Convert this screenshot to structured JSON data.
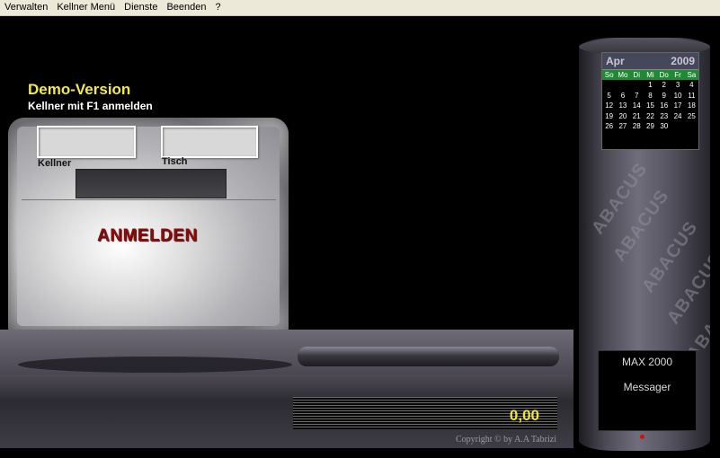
{
  "menu": {
    "items": [
      "Verwalten",
      "Kellner Menü",
      "Dienste",
      "Beenden",
      "?"
    ]
  },
  "banner": {
    "title": "Demo-Version",
    "subtitle": "Kellner mit F1 anmelden"
  },
  "login": {
    "kellner_label": "Kellner",
    "tisch_label": "Tisch",
    "kellner_value": "",
    "tisch_value": "",
    "display_value": "",
    "button_label": "ANMELDEN"
  },
  "display": {
    "amount": "0,00"
  },
  "copyright": "Copyright © by A.A Tabrizi",
  "watermark": "ABACUS",
  "calendar": {
    "month": "Apr",
    "year": "2009",
    "weekdays": [
      "So",
      "Mo",
      "Di",
      "Mi",
      "Do",
      "Fr",
      "Sa"
    ],
    "days": [
      "",
      "",
      "",
      "1",
      "2",
      "3",
      "4",
      "5",
      "6",
      "7",
      "8",
      "9",
      "10",
      "11",
      "12",
      "13",
      "14",
      "15",
      "16",
      "17",
      "18",
      "19",
      "20",
      "21",
      "22",
      "23",
      "24",
      "25",
      "26",
      "27",
      "28",
      "29",
      "30"
    ]
  },
  "messages": {
    "product": "MAX 2000",
    "messager": "Messager"
  },
  "colors": {
    "accent": "#f2ea47",
    "button_text": "#8c0a0a",
    "calendar_weekday_bg": "#1f8a33",
    "led": "#d01010"
  }
}
